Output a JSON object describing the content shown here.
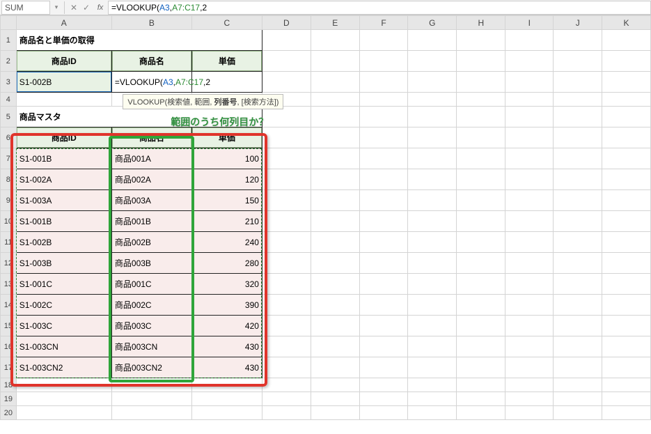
{
  "nameBox": "SUM",
  "fbButtons": {
    "cancel": "✕",
    "enter": "✓",
    "fx": "fx"
  },
  "formula": {
    "prefix": "=VLOOKUP(",
    "arg1": "A3",
    "comma1": ",",
    "arg2": "A7:C17",
    "comma2": ",",
    "arg3": "2"
  },
  "tooltip": {
    "fn": "VLOOKUP(",
    "a1": "検索値",
    "c": ", ",
    "a2": "範囲",
    "a3": "列番号",
    "a4": "[検索方法]",
    "end": ")"
  },
  "annotation": "範囲のうち何列目か？",
  "columns": [
    "A",
    "B",
    "C",
    "D",
    "E",
    "F",
    "G",
    "H",
    "I",
    "J",
    "K"
  ],
  "rows": [
    "1",
    "2",
    "3",
    "4",
    "5",
    "6",
    "7",
    "8",
    "9",
    "10",
    "11",
    "12",
    "13",
    "14",
    "15",
    "16",
    "17",
    "18",
    "19",
    "20"
  ],
  "titles": {
    "main": "商品名と単価の取得",
    "master": "商品マスタ"
  },
  "headers": {
    "id": "商品ID",
    "name": "商品名",
    "price": "単価"
  },
  "cells": {
    "a3": "S1-002B"
  },
  "master": [
    {
      "id": "S1-001B",
      "name": "商品001A",
      "price": "100"
    },
    {
      "id": "S1-002A",
      "name": "商品002A",
      "price": "120"
    },
    {
      "id": "S1-003A",
      "name": "商品003A",
      "price": "150"
    },
    {
      "id": "S1-001B",
      "name": "商品001B",
      "price": "210"
    },
    {
      "id": "S1-002B",
      "name": "商品002B",
      "price": "240"
    },
    {
      "id": "S1-003B",
      "name": "商品003B",
      "price": "280"
    },
    {
      "id": "S1-001C",
      "name": "商品001C",
      "price": "320"
    },
    {
      "id": "S1-002C",
      "name": "商品002C",
      "price": "390"
    },
    {
      "id": "S1-003C",
      "name": "商品003C",
      "price": "420"
    },
    {
      "id": "S1-003CN",
      "name": "商品003CN",
      "price": "430"
    },
    {
      "id": "S1-003CN2",
      "name": "商品003CN2",
      "price": "430"
    }
  ]
}
